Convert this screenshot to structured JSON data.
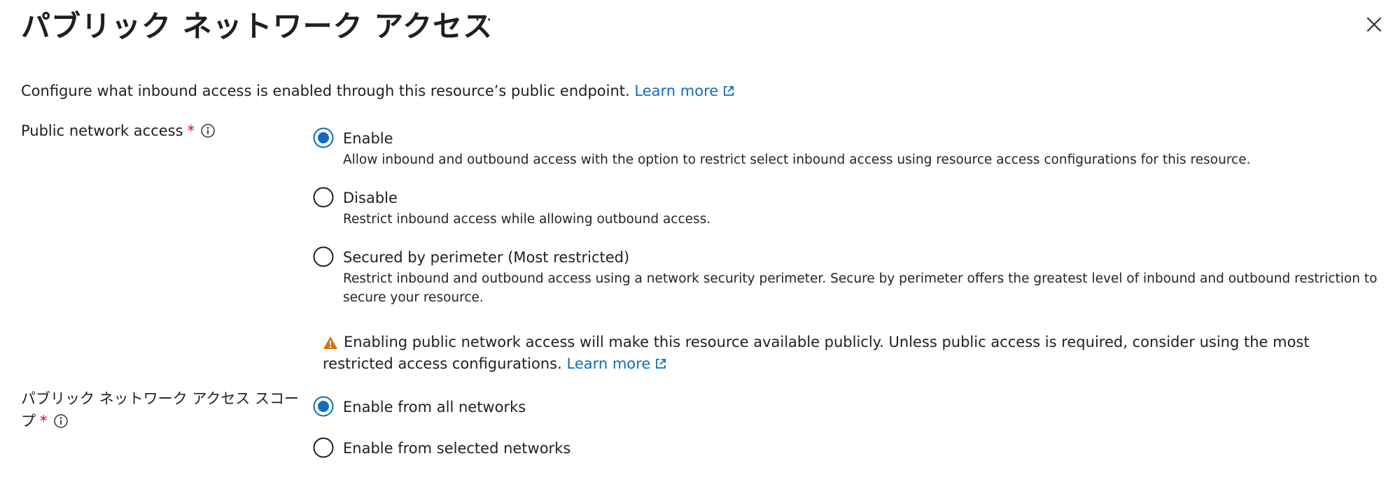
{
  "header": {
    "title": "パブリック ネットワーク アクセス",
    "more_label": "···"
  },
  "intro": {
    "text": "Configure what inbound access is enabled through this resource’s public endpoint.",
    "learn_more": "Learn more"
  },
  "public_network_access": {
    "label": "Public network access",
    "required_mark": "*",
    "selected": "Enable",
    "options": [
      {
        "label": "Enable",
        "description": "Allow inbound and outbound access with the option to restrict select inbound access using resource access configurations for this resource."
      },
      {
        "label": "Disable",
        "description": "Restrict inbound access while allowing outbound access."
      },
      {
        "label": "Secured by perimeter (Most restricted)",
        "description": "Restrict inbound and outbound access using a network security perimeter. Secure by perimeter offers the greatest level of inbound and outbound restriction to secure your resource."
      }
    ]
  },
  "warning": {
    "text": "Enabling public network access will make this resource available publicly. Unless public access is required, consider using the most restricted access configurations.",
    "learn_more": "Learn more",
    "color": "#da7108"
  },
  "access_scope": {
    "label": "パブリック ネットワーク アクセス スコープ",
    "required_mark": "*",
    "selected": "Enable from all networks",
    "options": [
      {
        "label": "Enable from all networks"
      },
      {
        "label": "Enable from selected networks"
      }
    ]
  },
  "colors": {
    "accent": "#0f6cbd",
    "required": "#c50f1f"
  }
}
